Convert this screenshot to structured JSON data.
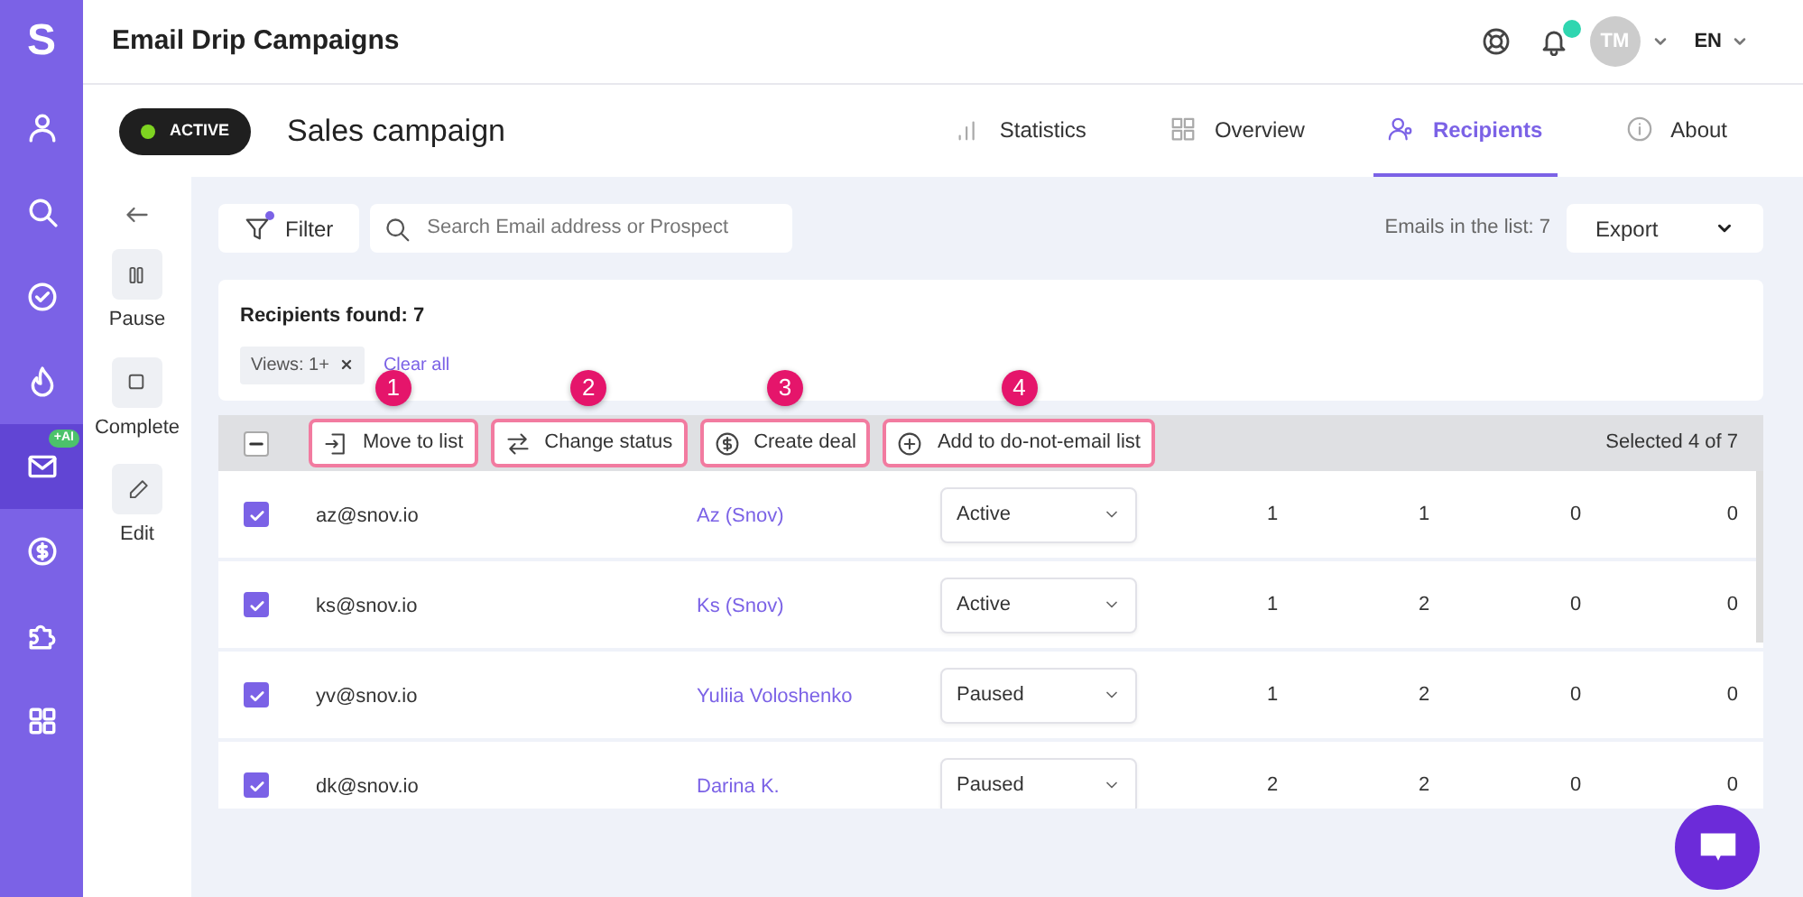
{
  "rail": {
    "logo": "S",
    "items": [
      {
        "kind": "person",
        "selected": false
      },
      {
        "kind": "search",
        "selected": false
      },
      {
        "kind": "check",
        "selected": false
      },
      {
        "kind": "flame",
        "selected": false
      },
      {
        "kind": "mail",
        "selected": true,
        "badge": "+AI"
      },
      {
        "kind": "dollar",
        "selected": false
      },
      {
        "kind": "puzzle",
        "selected": false
      },
      {
        "kind": "grid",
        "selected": false
      }
    ]
  },
  "header": {
    "title": "Email Drip Campaigns",
    "unread_notifications": true,
    "avatar": "TM",
    "language": "EN"
  },
  "campaign": {
    "status": "ACTIVE",
    "name": "Sales campaign"
  },
  "tabs": [
    {
      "label": "Statistics",
      "kind": "bars",
      "selected": false
    },
    {
      "label": "Overview",
      "kind": "tiles",
      "selected": false
    },
    {
      "label": "Recipients",
      "kind": "people",
      "selected": true
    },
    {
      "label": "About",
      "kind": "info",
      "selected": false
    }
  ],
  "actions": [
    {
      "label": "Pause",
      "kind": "pause"
    },
    {
      "label": "Complete",
      "kind": "stop"
    },
    {
      "label": "Edit",
      "kind": "pencil"
    }
  ],
  "toolbar": {
    "filter": "Filter",
    "filter_applied": true,
    "search_placeholder": "Search Email address or Prospect",
    "emails_count": "Emails in the list: 7",
    "export": "Export"
  },
  "summary": {
    "found": "Recipients found: 7",
    "chips": [
      {
        "label": "Views: 1+"
      }
    ],
    "clear": "Clear all"
  },
  "bulk": {
    "select_all_partial": true,
    "buttons": [
      {
        "label": "Move to list",
        "kind": "move",
        "marker": "1",
        "highlighted": true
      },
      {
        "label": "Change status",
        "kind": "swap",
        "marker": "2",
        "highlighted": true
      },
      {
        "label": "Create deal",
        "kind": "dollar",
        "marker": "3",
        "highlighted": true
      },
      {
        "label": "Add to do-not-email list",
        "kind": "plus",
        "marker": "4",
        "highlighted": true
      }
    ],
    "selection": "Selected 4 of 7"
  },
  "rows": [
    {
      "checked": true,
      "email": "az@snov.io",
      "prospect": "Az (Snov)",
      "status": "Active",
      "counts": [
        "1",
        "1",
        "0",
        "0"
      ]
    },
    {
      "checked": true,
      "email": "ks@snov.io",
      "prospect": "Ks (Snov)",
      "status": "Active",
      "counts": [
        "1",
        "2",
        "0",
        "0"
      ]
    },
    {
      "checked": true,
      "email": "yv@snov.io",
      "prospect": "Yuliia Voloshenko",
      "status": "Paused",
      "counts": [
        "1",
        "2",
        "0",
        "0"
      ]
    },
    {
      "checked": true,
      "email": "dk@snov.io",
      "prospect": "Darina K.",
      "status": "Paused",
      "counts": [
        "2",
        "2",
        "0",
        "0"
      ]
    }
  ]
}
